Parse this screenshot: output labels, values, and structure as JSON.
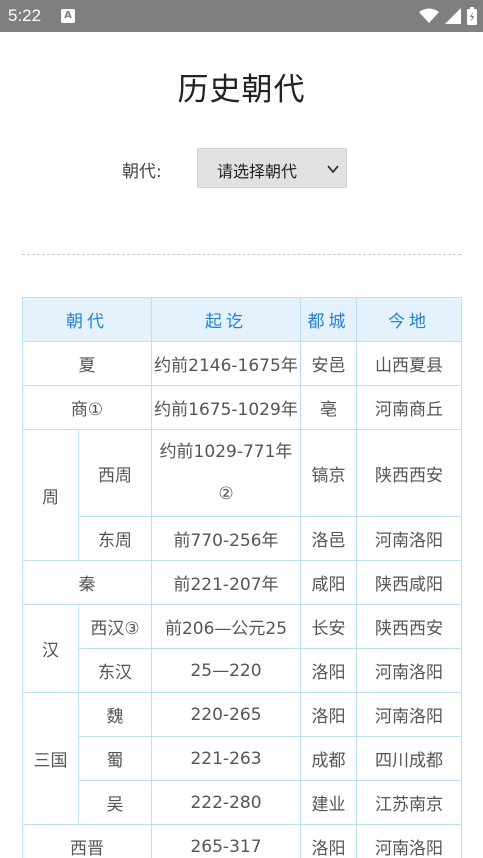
{
  "status": {
    "time": "5:22",
    "notif_icon": "A"
  },
  "page_title": "历史朝代",
  "selector": {
    "label": "朝代:",
    "value": "请选择朝代"
  },
  "table": {
    "headers": [
      "朝代",
      "起讫",
      "都城",
      "今地"
    ],
    "rows": [
      {
        "dynasty": "夏",
        "period": "约前2146-1675年",
        "capital": "安邑",
        "location": "山西夏县"
      },
      {
        "dynasty": "商①",
        "period": "约前1675-1029年",
        "capital": "亳",
        "location": "河南商丘"
      },
      {
        "group": "周",
        "sub": "西周",
        "period": "约前1029-771年②",
        "capital": "镐京",
        "location": "陕西西安"
      },
      {
        "group": "周",
        "sub": "东周",
        "period": "前770-256年",
        "capital": "洛邑",
        "location": "河南洛阳"
      },
      {
        "dynasty": "秦",
        "period": "前221-207年",
        "capital": "咸阳",
        "location": "陕西咸阳"
      },
      {
        "group": "汉",
        "sub": "西汉③",
        "period": "前206—公元25",
        "capital": "长安",
        "location": "陕西西安"
      },
      {
        "group": "汉",
        "sub": "东汉",
        "period": "25—220",
        "capital": "洛阳",
        "location": "河南洛阳"
      },
      {
        "group": "三国",
        "sub": "魏",
        "period": "220-265",
        "capital": "洛阳",
        "location": "河南洛阳"
      },
      {
        "group": "三国",
        "sub": "蜀",
        "period": "221-263",
        "capital": "成都",
        "location": "四川成都"
      },
      {
        "group": "三国",
        "sub": "吴",
        "period": "222-280",
        "capital": "建业",
        "location": "江苏南京"
      },
      {
        "dynasty": "西晋",
        "period": "265-317",
        "capital": "洛阳",
        "location": "河南洛阳"
      }
    ]
  }
}
